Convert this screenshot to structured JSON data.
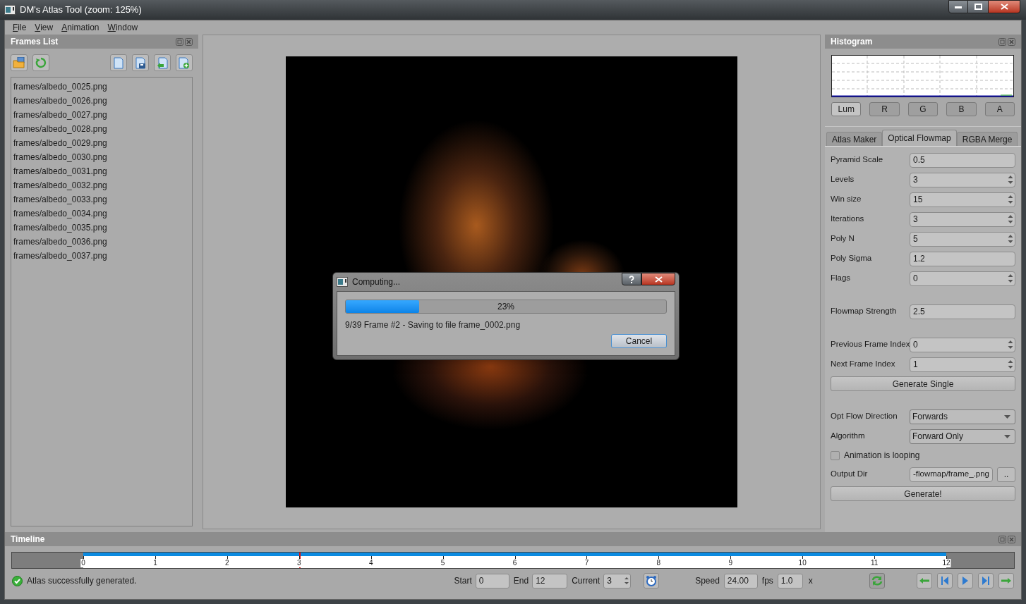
{
  "window": {
    "title": "DM's Atlas Tool (zoom: 125%)"
  },
  "menu": [
    {
      "label": "File"
    },
    {
      "label": "View"
    },
    {
      "label": "Animation"
    },
    {
      "label": "Window"
    }
  ],
  "frames_list": {
    "title": "Frames List",
    "items": [
      {
        "label": "frames/albedo_0025.png"
      },
      {
        "label": "frames/albedo_0026.png"
      },
      {
        "label": "frames/albedo_0027.png"
      },
      {
        "label": "frames/albedo_0028.png"
      },
      {
        "label": "frames/albedo_0029.png"
      },
      {
        "label": "frames/albedo_0030.png"
      },
      {
        "label": "frames/albedo_0031.png"
      },
      {
        "label": "frames/albedo_0032.png"
      },
      {
        "label": "frames/albedo_0033.png"
      },
      {
        "label": "frames/albedo_0034.png"
      },
      {
        "label": "frames/albedo_0035.png"
      },
      {
        "label": "frames/albedo_0036.png"
      },
      {
        "label": "frames/albedo_0037.png"
      }
    ]
  },
  "histogram": {
    "title": "Histogram",
    "channels": [
      {
        "label": "Lum",
        "selected": true
      },
      {
        "label": "R",
        "selected": false
      },
      {
        "label": "G",
        "selected": false
      },
      {
        "label": "B",
        "selected": false
      },
      {
        "label": "A",
        "selected": false
      }
    ]
  },
  "tabs": [
    {
      "label": "Atlas Maker",
      "selected": false
    },
    {
      "label": "Optical Flowmap",
      "selected": true
    },
    {
      "label": "RGBA Merge",
      "selected": false
    }
  ],
  "params": [
    {
      "kind": "text",
      "label": "Pyramid Scale",
      "value": "0.5"
    },
    {
      "kind": "spin",
      "label": "Levels",
      "value": "3"
    },
    {
      "kind": "spin",
      "label": "Win size",
      "value": "15"
    },
    {
      "kind": "spin",
      "label": "Iterations",
      "value": "3"
    },
    {
      "kind": "spin",
      "label": "Poly N",
      "value": "5"
    },
    {
      "kind": "text",
      "label": "Poly Sigma",
      "value": "1.2"
    },
    {
      "kind": "spin",
      "label": "Flags",
      "value": "0"
    },
    {
      "kind": "spacer"
    },
    {
      "kind": "text",
      "label": "Flowmap Strength",
      "value": "2.5"
    },
    {
      "kind": "spacer"
    },
    {
      "kind": "spin",
      "label": "Previous Frame Index",
      "value": "0"
    },
    {
      "kind": "spin",
      "label": "Next Frame Index",
      "value": "1"
    },
    {
      "kind": "button",
      "label": "Generate Single"
    },
    {
      "kind": "spacer"
    },
    {
      "kind": "combo",
      "label": "Opt Flow Direction",
      "value": "Forwards"
    },
    {
      "kind": "combo",
      "label": "Algorithm",
      "value": "Forward Only"
    },
    {
      "kind": "checkbox",
      "label": "Animation is looping",
      "checked": false
    },
    {
      "kind": "file",
      "label": "Output Dir",
      "value": "-flowmap/frame_.png",
      "browse": ".."
    },
    {
      "kind": "button",
      "label": "Generate!"
    }
  ],
  "dialog": {
    "title": "Computing...",
    "progress": {
      "level": 0.23,
      "reading": "23%"
    },
    "message": "9/39 Frame #2 - Saving to file frame_0002.png",
    "button": "Cancel"
  },
  "timeline": {
    "title": "Timeline",
    "ticks": [
      "0",
      "1",
      "2",
      "3",
      "4",
      "5",
      "6",
      "7",
      "8",
      "9",
      "10",
      "11",
      "12"
    ],
    "playhead": {
      "level": 0.25
    },
    "status": "Atlas successfully generated.",
    "start_label": "Start",
    "start": "0",
    "end_label": "End",
    "end": "12",
    "current_label": "Current",
    "current": "3",
    "speed_label": "Speed",
    "speed": "24.00",
    "fps_label": "fps",
    "multiplier": "1.0",
    "x_label": "x"
  }
}
